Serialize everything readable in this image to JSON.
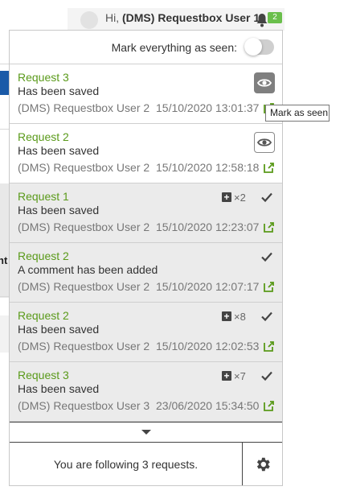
{
  "header": {
    "greeting_prefix": "Hi, ",
    "user_name": "(DMS) Requestbox User 1",
    "notification_count": "2"
  },
  "panel": {
    "mark_all_label": "Mark everything as seen:",
    "mark_all_on": false,
    "notifications": [
      {
        "title": "Request 3",
        "message": "Has been saved",
        "author": "(DMS) Requestbox User 2",
        "date": "15/10/2020 13:01:37",
        "seen": false,
        "count": ""
      },
      {
        "title": "Request 2",
        "message": "Has been saved",
        "author": "(DMS) Requestbox User 2",
        "date": "15/10/2020 12:58:18",
        "seen": false,
        "count": ""
      },
      {
        "title": "Request 1",
        "message": "Has been saved",
        "author": "(DMS) Requestbox User 2",
        "date": "15/10/2020 12:23:07",
        "seen": true,
        "count": "×2"
      },
      {
        "title": "Request 2",
        "message": "A comment has been added",
        "author": "(DMS) Requestbox User 2",
        "date": "15/10/2020 12:07:17",
        "seen": true,
        "count": ""
      },
      {
        "title": "Request 2",
        "message": "Has been saved",
        "author": "(DMS) Requestbox User 2",
        "date": "15/10/2020 12:02:53",
        "seen": true,
        "count": "×8"
      },
      {
        "title": "Request 3",
        "message": "Has been saved",
        "author": "(DMS) Requestbox User 3",
        "date": "23/06/2020 15:34:50",
        "seen": true,
        "count": "×7"
      }
    ],
    "footer_text": "You are following 3 requests.",
    "tooltip": "Mark as seen"
  },
  "background": {
    "fragment_text": "nt"
  },
  "colors": {
    "title_green": "#5a9a1a",
    "badge_green": "#6abf4b",
    "seen_bg": "#ebebeb"
  },
  "icons": {
    "bell": "bell-icon",
    "eye": "eye-icon",
    "check": "check-icon",
    "open": "external-link-icon",
    "plus": "plus-square-icon",
    "caret": "caret-down-icon",
    "gear": "gear-icon"
  }
}
